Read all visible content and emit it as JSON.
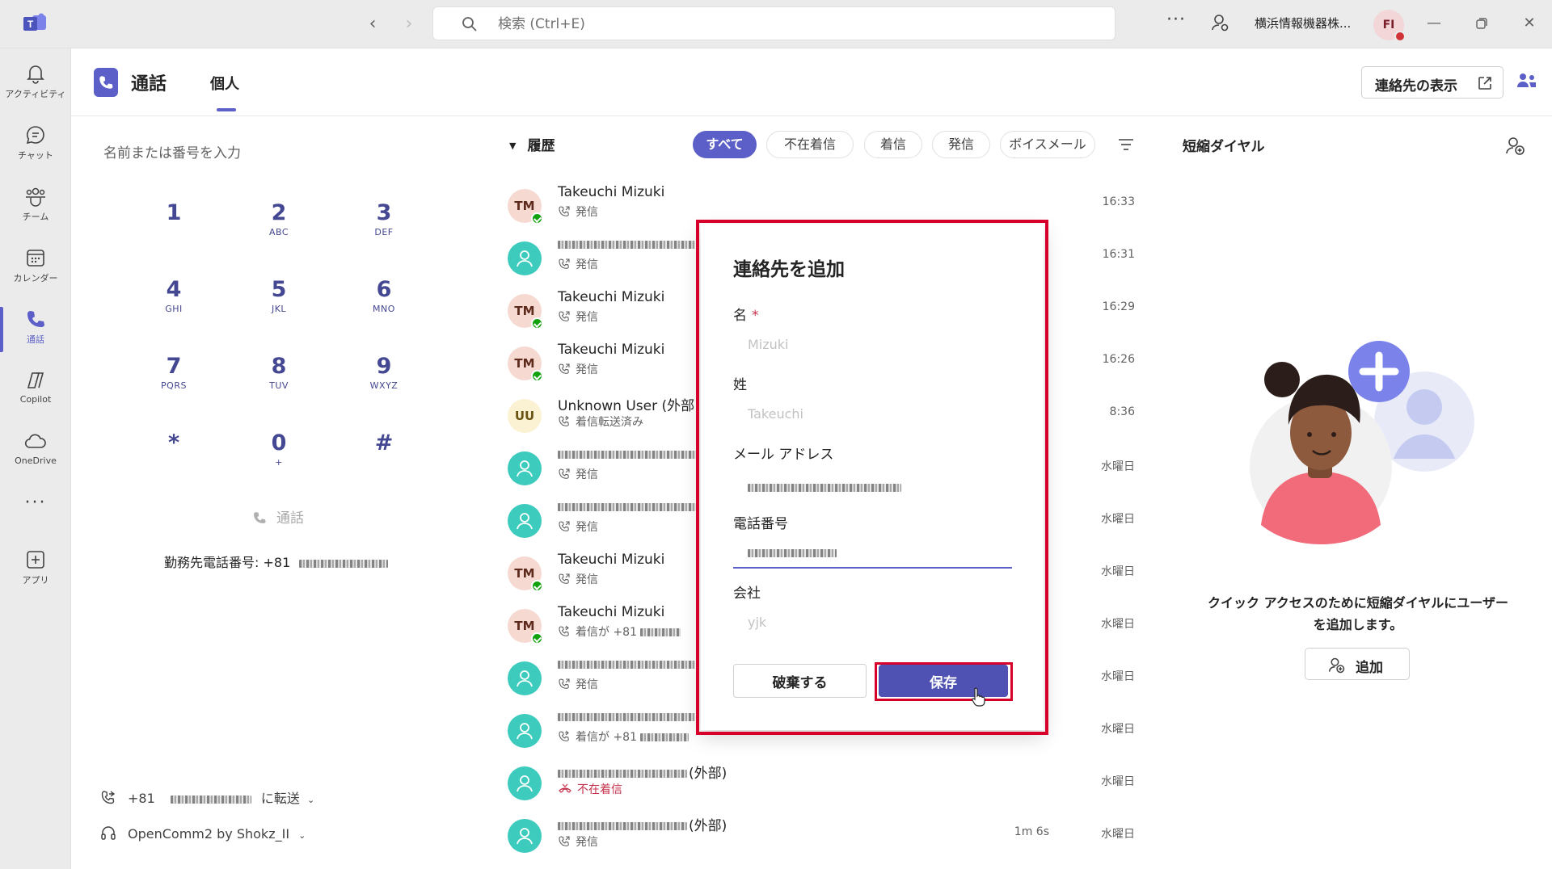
{
  "titlebar": {
    "search_placeholder": "検索 (Ctrl+E)",
    "org_name": "横浜情報機器株...",
    "avatar_initials": "FI",
    "more": "···"
  },
  "rail": {
    "items": [
      {
        "label": "アクティビティ",
        "icon": "bell-icon"
      },
      {
        "label": "チャット",
        "icon": "chat-icon"
      },
      {
        "label": "チーム",
        "icon": "teams-icon"
      },
      {
        "label": "カレンダー",
        "icon": "calendar-icon"
      },
      {
        "label": "通話",
        "icon": "phone-icon"
      },
      {
        "label": "Copilot",
        "icon": "copilot-icon"
      },
      {
        "label": "OneDrive",
        "icon": "cloud-icon"
      },
      {
        "label": "アプリ",
        "icon": "add-app-icon"
      }
    ],
    "more": "···"
  },
  "header": {
    "title": "通話",
    "tab_personal": "個人",
    "show_contacts": "連絡先の表示"
  },
  "dialpad": {
    "placeholder": "名前または番号を入力",
    "keys": [
      {
        "digit": "1",
        "letters": ""
      },
      {
        "digit": "2",
        "letters": "ABC"
      },
      {
        "digit": "3",
        "letters": "DEF"
      },
      {
        "digit": "4",
        "letters": "GHI"
      },
      {
        "digit": "5",
        "letters": "JKL"
      },
      {
        "digit": "6",
        "letters": "MNO"
      },
      {
        "digit": "7",
        "letters": "PQRS"
      },
      {
        "digit": "8",
        "letters": "TUV"
      },
      {
        "digit": "9",
        "letters": "WXYZ"
      },
      {
        "digit": "*",
        "letters": ""
      },
      {
        "digit": "0",
        "letters": "+"
      },
      {
        "digit": "#",
        "letters": ""
      }
    ],
    "call_label": "通話",
    "work_number_label": "勤務先電話番号: +81",
    "forward_prefix": "+81",
    "forward_label": "に転送",
    "device_label": "OpenComm2 by Shokz_II"
  },
  "history": {
    "title": "履歴",
    "filters": [
      "すべて",
      "不在着信",
      "着信",
      "発信",
      "ボイスメール"
    ],
    "rows": [
      {
        "avatar": "TM",
        "name": "Takeuchi Mizuki",
        "sub": "発信",
        "time": "16:33"
      },
      {
        "avatar": "",
        "name": "",
        "sub": "発信",
        "time": "16:31"
      },
      {
        "avatar": "TM",
        "name": "Takeuchi Mizuki",
        "sub": "発信",
        "time": "16:29"
      },
      {
        "avatar": "TM",
        "name": "Takeuchi Mizuki",
        "sub": "発信",
        "time": "16:26"
      },
      {
        "avatar": "UU",
        "name": "Unknown User (外部",
        "sub": "着信転送済み",
        "time": "8:36"
      },
      {
        "avatar": "",
        "name": "",
        "sub": "発信",
        "time": "水曜日"
      },
      {
        "avatar": "",
        "name": "",
        "sub": "発信",
        "time": "水曜日"
      },
      {
        "avatar": "TM",
        "name": "Takeuchi Mizuki",
        "sub": "発信",
        "time": "水曜日"
      },
      {
        "avatar": "TM",
        "name": "Takeuchi Mizuki",
        "sub": "着信が +81",
        "time": "水曜日"
      },
      {
        "avatar": "",
        "name": "",
        "sub": "発信",
        "time": "水曜日"
      },
      {
        "avatar": "",
        "name": "",
        "sub": "着信が +81",
        "time": "水曜日"
      },
      {
        "avatar": "",
        "name": "(外部)",
        "sub": "不在着信",
        "time": "水曜日"
      },
      {
        "avatar": "",
        "name": "(外部)",
        "sub": "発信",
        "time": "水曜日",
        "duration": "1m 6s"
      }
    ]
  },
  "speed_dial": {
    "title": "短縮ダイヤル",
    "description": "クイック アクセスのために短縮ダイヤルにユーザーを追加します。",
    "add_label": "追加"
  },
  "dialog": {
    "title": "連絡先を追加",
    "first_name_label": "名",
    "required_mark": "*",
    "first_name_placeholder": "Mizuki",
    "last_name_label": "姓",
    "last_name_placeholder": "Takeuchi",
    "email_label": "メール アドレス",
    "phone_label": "電話番号",
    "company_label": "会社",
    "company_placeholder": "yjk",
    "discard_label": "破棄する",
    "save_label": "保存"
  },
  "colors": {
    "accent": "#5b5fc7",
    "save": "#4f52b2",
    "highlight": "#d7002a",
    "presence": "#13a10e",
    "teal_avatar": "#3ccbbd"
  }
}
